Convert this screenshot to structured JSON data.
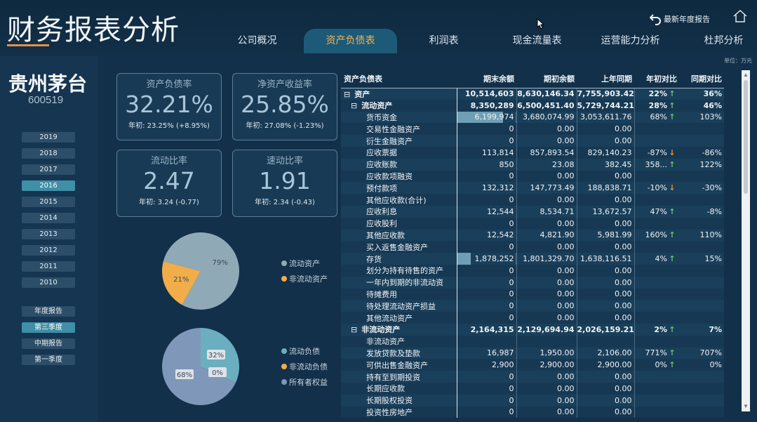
{
  "header": {
    "title": "财务报表分析",
    "tabs": [
      {
        "label": "公司概况",
        "active": false
      },
      {
        "label": "资产负债表",
        "active": true
      },
      {
        "label": "利润表",
        "active": false
      },
      {
        "label": "现金流量表",
        "active": false
      },
      {
        "label": "运营能力分析",
        "active": false
      },
      {
        "label": "杜邦分析",
        "active": false
      }
    ],
    "latest_report_label": "最新年度报告",
    "unit_label": "单位：万元",
    "icons": {
      "back": "undo-arrow-icon",
      "home": "home-icon"
    },
    "active_tab_color": "#f5b452"
  },
  "sidebar": {
    "company_name": "贵州茅台",
    "company_code": "600519",
    "years": [
      "2019",
      "2018",
      "2017",
      "2016",
      "2015",
      "2014",
      "2013",
      "2012",
      "2011",
      "2010"
    ],
    "active_year": "2016",
    "periods": [
      "年度报告",
      "第三季度",
      "中期报告",
      "第一季度"
    ],
    "active_period": "第三季度"
  },
  "kpis": [
    {
      "title": "资产负债率",
      "value": "32.21%",
      "sub": "年初: 23.25% (+8.95%)"
    },
    {
      "title": "净资产收益率",
      "value": "25.85%",
      "sub": "年初: 27.08% (-1.23%)"
    },
    {
      "title": "流动比率",
      "value": "2.47",
      "sub": "年初: 3.24 (-0.77)"
    },
    {
      "title": "速动比率",
      "value": "1.91",
      "sub": "年初: 2.34 (-0.43)"
    }
  ],
  "chart_data": [
    {
      "type": "pie",
      "labels": [
        "流动资产",
        "非流动资产"
      ],
      "values": [
        79,
        21
      ],
      "value_labels": [
        "79%",
        "21%"
      ],
      "colors": [
        "#8fa9b6",
        "#f1ad4a"
      ],
      "legend": "right"
    },
    {
      "type": "pie",
      "labels": [
        "流动负债",
        "非流动负债",
        "所有者权益"
      ],
      "values": [
        32,
        0,
        68
      ],
      "value_labels": [
        "32%",
        "0%",
        "68%"
      ],
      "colors": [
        "#6aaebf",
        "#f1ad4a",
        "#7f97b9"
      ],
      "legend": "right"
    }
  ],
  "table": {
    "columns": [
      "资产负债表",
      "期末余额",
      "期初余额",
      "上年同期",
      "年初对比",
      "同期对比"
    ],
    "rows": [
      {
        "label": "资产",
        "level": 0,
        "expand": "⊟",
        "bold": true,
        "end": "10,514,603",
        "begin": "8,630,146.34",
        "last": "7,755,903.42",
        "yoy": "22%",
        "yoy_dir": "up",
        "same": "36%"
      },
      {
        "label": "流动资产",
        "level": 1,
        "expand": "⊟",
        "bold": true,
        "end": "8,350,289",
        "begin": "6,500,451.40",
        "last": "5,729,744.21",
        "yoy": "28%",
        "yoy_dir": "up",
        "same": "46%"
      },
      {
        "label": "货币资金",
        "level": 2,
        "bold": false,
        "end": "6,199,974",
        "end_bar": 0.78,
        "begin": "3,680,074.99",
        "last": "3,053,611.76",
        "yoy": "68%",
        "yoy_dir": "up",
        "same": "103%"
      },
      {
        "label": "交易性金融资产",
        "level": 2,
        "bold": false,
        "end": "0",
        "begin": "0.00",
        "last": "0.00",
        "yoy": "",
        "yoy_dir": "",
        "same": ""
      },
      {
        "label": "衍生金融资产",
        "level": 2,
        "bold": false,
        "end": "0",
        "begin": "0.00",
        "last": "0.00",
        "yoy": "",
        "yoy_dir": "",
        "same": ""
      },
      {
        "label": "应收票据",
        "level": 2,
        "bold": false,
        "end": "113,814",
        "begin": "857,893.54",
        "last": "829,140.23",
        "yoy": "-87%",
        "yoy_dir": "down",
        "same": "-86%"
      },
      {
        "label": "应收账款",
        "level": 2,
        "bold": false,
        "end": "850",
        "begin": "23.08",
        "last": "382.45",
        "yoy": "358...",
        "yoy_dir": "up",
        "same": "122%"
      },
      {
        "label": "应收款项融资",
        "level": 2,
        "bold": false,
        "end": "0",
        "begin": "0.00",
        "last": "0.00",
        "yoy": "",
        "yoy_dir": "",
        "same": ""
      },
      {
        "label": "预付款项",
        "level": 2,
        "bold": false,
        "end": "132,312",
        "begin": "147,773.49",
        "last": "188,838.71",
        "yoy": "-10%",
        "yoy_dir": "down",
        "same": "-30%"
      },
      {
        "label": "其他应收款(合计)",
        "level": 2,
        "bold": false,
        "end": "0",
        "begin": "0.00",
        "last": "0.00",
        "yoy": "",
        "yoy_dir": "",
        "same": ""
      },
      {
        "label": "应收利息",
        "level": 2,
        "bold": false,
        "end": "12,544",
        "begin": "8,534.71",
        "last": "13,672.57",
        "yoy": "47%",
        "yoy_dir": "up",
        "same": "-8%"
      },
      {
        "label": "应收股利",
        "level": 2,
        "bold": false,
        "end": "0",
        "begin": "0.00",
        "last": "0.00",
        "yoy": "",
        "yoy_dir": "",
        "same": ""
      },
      {
        "label": "其他应收款",
        "level": 2,
        "bold": false,
        "end": "12,542",
        "begin": "4,821.90",
        "last": "5,981.99",
        "yoy": "160%",
        "yoy_dir": "up",
        "same": "110%"
      },
      {
        "label": "买入返售金融资产",
        "level": 2,
        "bold": false,
        "end": "0",
        "begin": "0.00",
        "last": "0.00",
        "yoy": "",
        "yoy_dir": "",
        "same": ""
      },
      {
        "label": "存货",
        "level": 2,
        "bold": false,
        "end": "1,878,252",
        "end_bar": 0.23,
        "begin": "1,801,329.70",
        "last": "1,638,116.51",
        "yoy": "4%",
        "yoy_dir": "up",
        "same": "15%"
      },
      {
        "label": "划分为持有待售的资产",
        "level": 2,
        "bold": false,
        "end": "0",
        "begin": "0.00",
        "last": "0.00",
        "yoy": "",
        "yoy_dir": "",
        "same": ""
      },
      {
        "label": "一年内到期的非流动资",
        "level": 2,
        "bold": false,
        "end": "0",
        "begin": "0.00",
        "last": "0.00",
        "yoy": "",
        "yoy_dir": "",
        "same": ""
      },
      {
        "label": "待摊费用",
        "level": 2,
        "bold": false,
        "end": "0",
        "begin": "0.00",
        "last": "0.00",
        "yoy": "",
        "yoy_dir": "",
        "same": ""
      },
      {
        "label": "待处理流动资产损益",
        "level": 2,
        "bold": false,
        "end": "0",
        "begin": "0.00",
        "last": "0.00",
        "yoy": "",
        "yoy_dir": "",
        "same": ""
      },
      {
        "label": "其他流动资产",
        "level": 2,
        "bold": false,
        "end": "0",
        "begin": "0.00",
        "last": "0.00",
        "yoy": "",
        "yoy_dir": "",
        "same": ""
      },
      {
        "label": "非流动资产",
        "level": 1,
        "expand": "⊟",
        "bold": true,
        "end": "2,164,315",
        "begin": "2,129,694.94",
        "last": "2,026,159.21",
        "yoy": "2%",
        "yoy_dir": "up",
        "same": "7%"
      },
      {
        "label": "非流动资产",
        "level": 2,
        "bold": false,
        "end": "",
        "begin": "",
        "last": "",
        "yoy": "",
        "yoy_dir": "",
        "same": ""
      },
      {
        "label": "发放贷款及垫款",
        "level": 2,
        "bold": false,
        "end": "16,987",
        "begin": "1,950.00",
        "last": "2,106.00",
        "yoy": "771%",
        "yoy_dir": "up",
        "same": "707%"
      },
      {
        "label": "可供出售金融资产",
        "level": 2,
        "bold": false,
        "end": "2,900",
        "begin": "2,900.00",
        "last": "2,900.00",
        "yoy": "0%",
        "yoy_dir": "up",
        "same": "0%"
      },
      {
        "label": "持有至到期投资",
        "level": 2,
        "bold": false,
        "end": "0",
        "begin": "0.00",
        "last": "0.00",
        "yoy": "",
        "yoy_dir": "",
        "same": ""
      },
      {
        "label": "长期应收款",
        "level": 2,
        "bold": false,
        "end": "0",
        "begin": "0.00",
        "last": "0.00",
        "yoy": "",
        "yoy_dir": "",
        "same": ""
      },
      {
        "label": "长期股权投资",
        "level": 2,
        "bold": false,
        "end": "0",
        "begin": "0.00",
        "last": "0.00",
        "yoy": "",
        "yoy_dir": "",
        "same": ""
      },
      {
        "label": "投资性房地产",
        "level": 2,
        "bold": false,
        "end": "0",
        "begin": "0.00",
        "last": "0.00",
        "yoy": "",
        "yoy_dir": "",
        "same": ""
      }
    ],
    "arrow_up_color": "#6fbf73",
    "arrow_down_color": "#f0942b",
    "bar_color": "#6e9fb4"
  }
}
